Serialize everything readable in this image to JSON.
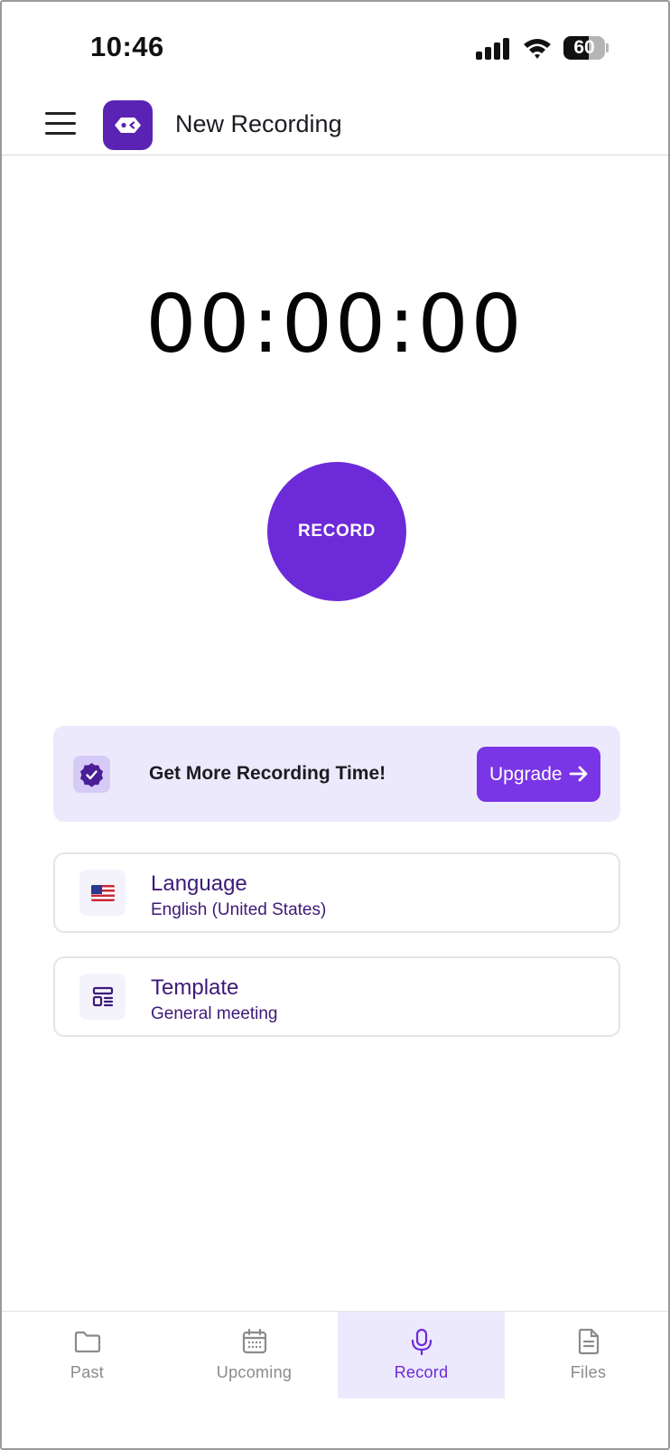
{
  "status_bar": {
    "time": "10:46",
    "battery": "60",
    "battery_level": 0.6
  },
  "header": {
    "title": "New Recording",
    "menu_icon": "hamburger-menu-icon",
    "logo_icon": "app-logo-icon"
  },
  "timer": {
    "display": "00:00:00"
  },
  "record": {
    "label": "RECORD"
  },
  "upgrade": {
    "message": "Get More Recording Time!",
    "button_label": "Upgrade",
    "badge_icon": "verified-badge-icon",
    "arrow_icon": "arrow-right-icon"
  },
  "options": [
    {
      "title": "Language",
      "value": "English (United States)",
      "icon": "us-flag-icon"
    },
    {
      "title": "Template",
      "value": "General meeting",
      "icon": "template-layout-icon"
    }
  ],
  "nav": {
    "tabs": [
      {
        "label": "Past",
        "icon": "folder-icon"
      },
      {
        "label": "Upcoming",
        "icon": "calendar-icon"
      },
      {
        "label": "Record",
        "icon": "microphone-icon",
        "active": true
      },
      {
        "label": "Files",
        "icon": "document-icon"
      }
    ]
  },
  "colors": {
    "accent": "#6d2ad9",
    "accent_light": "#ede9fc",
    "brand": "#5a23b4",
    "text_purple": "#3d1a78"
  }
}
